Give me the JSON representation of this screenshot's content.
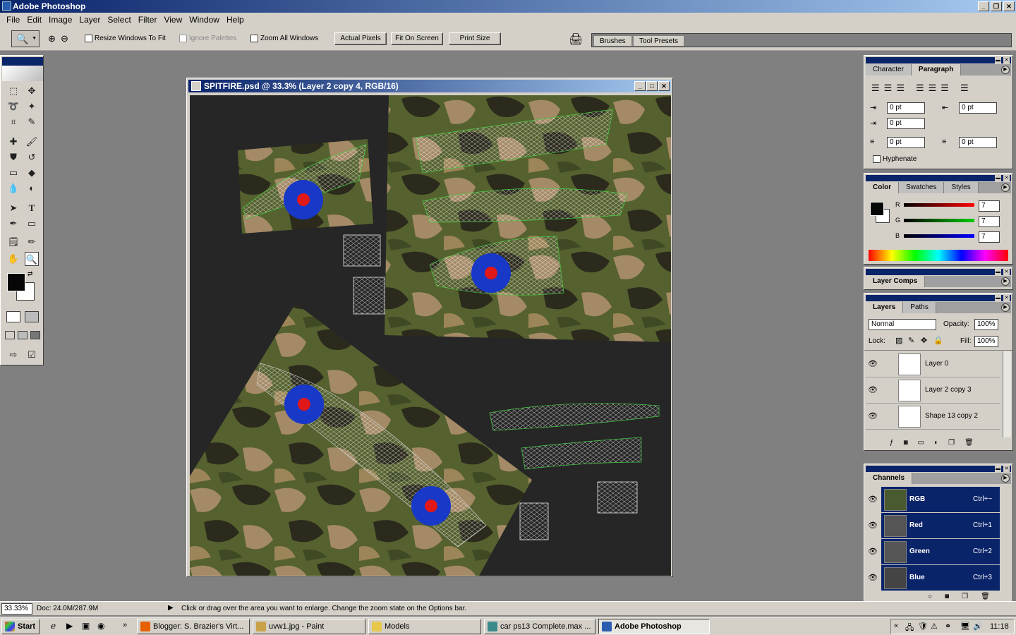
{
  "app": {
    "title": "Adobe Photoshop"
  },
  "menu": [
    "File",
    "Edit",
    "Image",
    "Layer",
    "Select",
    "Filter",
    "View",
    "Window",
    "Help"
  ],
  "options": {
    "resize": "Resize Windows To Fit",
    "ignore": "Ignore Palettes",
    "zoomall": "Zoom All Windows",
    "actual": "Actual Pixels",
    "fit": "Fit On Screen",
    "print": "Print Size"
  },
  "palette_well": {
    "brushes": "Brushes",
    "presets": "Tool Presets"
  },
  "document": {
    "title": "SPITFIRE.psd @ 33.3% (Layer 2 copy 4, RGB/16)"
  },
  "paragraph": {
    "tab1": "Character",
    "tab2": "Paragraph",
    "v1": "0 pt",
    "v2": "0 pt",
    "v3": "0 pt",
    "v4": "0 pt",
    "v5": "0 pt",
    "hyphenate": "Hyphenate"
  },
  "color": {
    "tab1": "Color",
    "tab2": "Swatches",
    "tab3": "Styles",
    "r_label": "R",
    "g_label": "G",
    "b_label": "B",
    "r": "7",
    "g": "7",
    "b": "7"
  },
  "layercomps": {
    "title": "Layer Comps"
  },
  "layers": {
    "tab1": "Layers",
    "tab2": "Paths",
    "mode": "Normal",
    "opacity_label": "Opacity:",
    "opacity": "100%",
    "lock_label": "Lock:",
    "fill_label": "Fill:",
    "fill": "100%",
    "items": [
      "Layer 0",
      "Layer 2 copy 3",
      "Shape 13 copy 2"
    ]
  },
  "channels": {
    "title": "Channels",
    "items": [
      {
        "name": "RGB",
        "key": "Ctrl+~"
      },
      {
        "name": "Red",
        "key": "Ctrl+1"
      },
      {
        "name": "Green",
        "key": "Ctrl+2"
      },
      {
        "name": "Blue",
        "key": "Ctrl+3"
      }
    ]
  },
  "status": {
    "zoom": "33.33%",
    "doc": "Doc: 24.0M/287.9M",
    "hint": "Click or drag over the area you want to enlarge. Change the zoom state on the Options bar."
  },
  "taskbar": {
    "start": "Start",
    "tasks": [
      "Blogger: S. Brazier's Virt...",
      "uvw1.jpg - Paint",
      "Models",
      "car ps13  Complete.max ...",
      "Adobe Photoshop"
    ],
    "clock": "11:18"
  },
  "colors": {
    "titlebar": "#0a246a",
    "chrome": "#d4d0c8",
    "canvas": "#262626"
  }
}
